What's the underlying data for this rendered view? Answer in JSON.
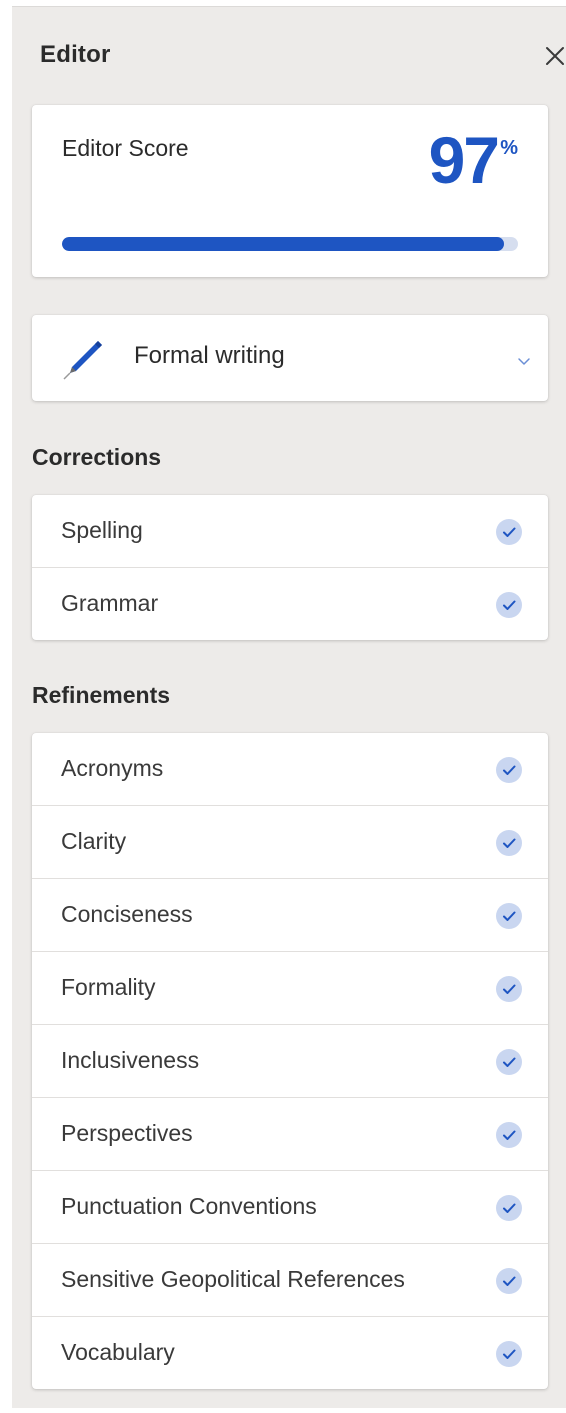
{
  "pane": {
    "title": "Editor"
  },
  "score": {
    "label": "Editor Score",
    "value": "97",
    "percent_sign": "%",
    "progress_fraction": 0.97
  },
  "writing_style": {
    "selected": "Formal writing"
  },
  "corrections": {
    "heading": "Corrections",
    "items": [
      {
        "label": "Spelling"
      },
      {
        "label": "Grammar"
      }
    ]
  },
  "refinements": {
    "heading": "Refinements",
    "items": [
      {
        "label": "Acronyms"
      },
      {
        "label": "Clarity"
      },
      {
        "label": "Conciseness"
      },
      {
        "label": "Formality"
      },
      {
        "label": "Inclusiveness"
      },
      {
        "label": "Perspectives"
      },
      {
        "label": "Punctuation Conventions"
      },
      {
        "label": "Sensitive Geopolitical References"
      },
      {
        "label": "Vocabulary"
      }
    ]
  },
  "colors": {
    "accent": "#1e55c2",
    "pane_background": "#edebe9",
    "check_background": "#c9d6f0"
  },
  "icons": {
    "close": "close-icon",
    "pen": "pen-icon",
    "chevron": "chevron-down-icon",
    "check": "check-circle-icon"
  }
}
